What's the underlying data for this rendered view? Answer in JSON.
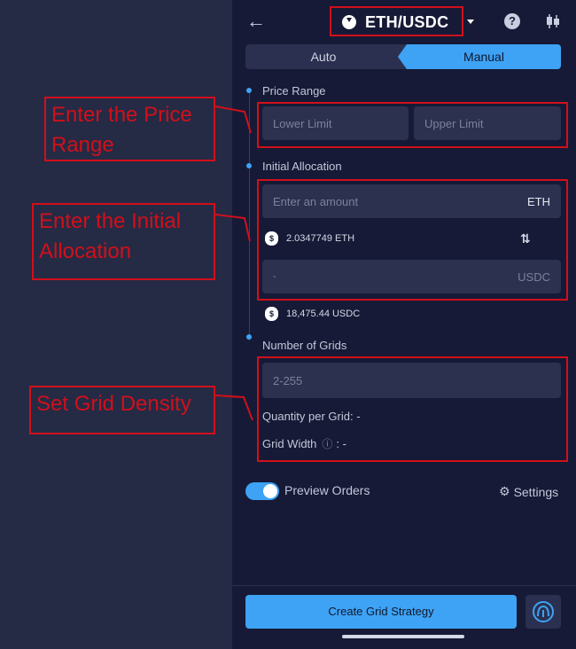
{
  "header": {
    "pair": "ETH/USDC"
  },
  "tabs": {
    "auto": "Auto",
    "manual": "Manual"
  },
  "price_range": {
    "label": "Price Range",
    "lower_placeholder": "Lower Limit",
    "upper_placeholder": "Upper Limit"
  },
  "initial_allocation": {
    "label": "Initial Allocation",
    "amount_placeholder": "Enter an amount",
    "amount_unit": "ETH",
    "eth_balance": "2.0347749 ETH",
    "quote_value": "-",
    "quote_unit": "USDC",
    "usdc_balance": "18,475.44 USDC"
  },
  "grids": {
    "label": "Number of Grids",
    "placeholder": "2-255",
    "quantity_per_grid": "Quantity per Grid: -",
    "grid_width_label": "Grid Width",
    "grid_width_value": ": -"
  },
  "preview": {
    "label": "Preview Orders",
    "enabled": true
  },
  "settings": {
    "label": "Settings"
  },
  "footer": {
    "create_button": "Create Grid Strategy"
  },
  "annotations": {
    "price_range": [
      "Enter the Price",
      "Range"
    ],
    "initial_allocation": [
      "Enter the Initial",
      "Allocation"
    ],
    "grid_density": "Set Grid Density"
  },
  "colors": {
    "accent": "#3ea3f5",
    "panel_bg": "#161a36",
    "page_bg": "#252a45",
    "field_bg": "#2c3150",
    "annotation_red": "#d1101a"
  }
}
